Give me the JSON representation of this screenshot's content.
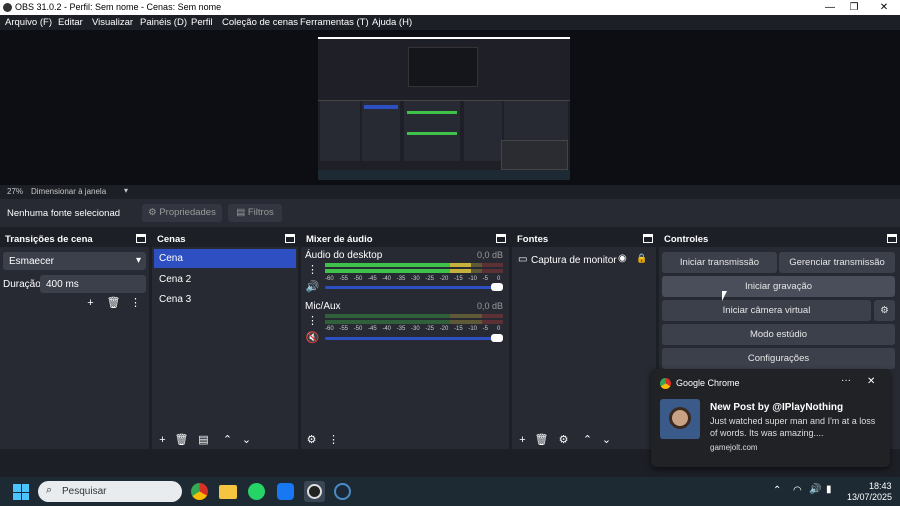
{
  "window": {
    "title": "OBS 31.0.2 - Perfil: Sem nome - Cenas: Sem nome"
  },
  "menu": [
    "Arquivo (F)",
    "Editar",
    "Visualizar",
    "Painéis (D)",
    "Perfil",
    "Coleção de cenas",
    "Ferramentas (T)",
    "Ajuda (H)"
  ],
  "status": {
    "zoom": "27%",
    "scale_mode": "Dimensionar à janela"
  },
  "source_bar": {
    "no_source": "Nenhuma fonte selecionad",
    "properties": "Propriedades",
    "filters": "Filtros"
  },
  "transitions": {
    "title": "Transições de cena",
    "selected": "Esmaecer",
    "duration_label": "Duração",
    "duration_value": "400 ms"
  },
  "scenes": {
    "title": "Cenas",
    "items": [
      "Cena",
      "Cena 2",
      "Cena 3"
    ]
  },
  "mixer": {
    "title": "Mixer de áudio",
    "channels": [
      {
        "name": "Áudio do desktop",
        "db": "0,0 dB",
        "level": 0.82
      },
      {
        "name": "Mic/Aux",
        "db": "0,0 dB",
        "level": 0
      }
    ],
    "scale": [
      "-60",
      "-55",
      "-50",
      "-45",
      "-40",
      "-35",
      "-30",
      "-25",
      "-20",
      "-15",
      "-10",
      "-5",
      "0"
    ]
  },
  "sources": {
    "title": "Fontes",
    "items": [
      "Captura de monitor"
    ]
  },
  "controls": {
    "title": "Controles",
    "start_stream": "Iniciar transmissão",
    "manage_stream": "Gerenciar transmissão",
    "start_record": "Iniciar gravação",
    "start_virtual_cam": "Iniciar câmera virtual",
    "studio_mode": "Modo estúdio",
    "settings": "Configurações"
  },
  "notification": {
    "app": "Google Chrome",
    "title": "New Post by @IPlayNothing",
    "body": "Just watched super man and I'm at a loss of words. Its was amazing....",
    "source": "gamejolt.com"
  },
  "taskbar": {
    "search_placeholder": "Pesquisar",
    "time": "18:43",
    "date": "13/07/2025"
  },
  "colors": {
    "accent": "#2d4fc2",
    "meter_green": "#3ec24a",
    "meter_yellow": "#c6b23b",
    "meter_red": "#c23b3b",
    "mute_red": "#d23b3b"
  }
}
